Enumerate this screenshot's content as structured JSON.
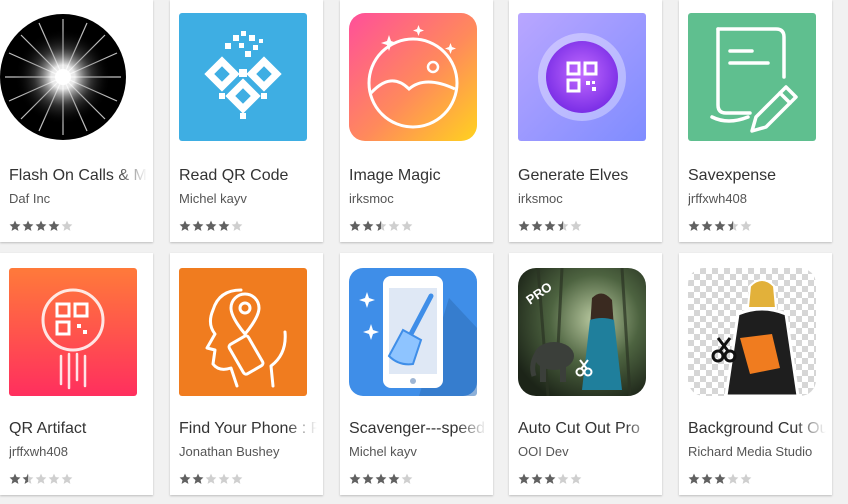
{
  "colors": {
    "star_on": "#616161",
    "star_off": "#cfcfcf"
  },
  "apps": [
    {
      "title": "Flash On Calls & Messages",
      "developer": "Daf Inc",
      "rating": 4,
      "icon": "flash-burst-icon"
    },
    {
      "title": "Read QR Code",
      "developer": "Michel kayv",
      "rating": 4,
      "icon": "qr-code-icon"
    },
    {
      "title": "Image Magic",
      "developer": "irksmoc",
      "rating": 2.5,
      "icon": "landscape-circle-icon"
    },
    {
      "title": "Generate Elves",
      "developer": "irksmoc",
      "rating": 3.5,
      "icon": "qr-orb-icon"
    },
    {
      "title": "Savexpense",
      "developer": "jrffxwh408",
      "rating": 3.5,
      "icon": "document-pen-icon"
    },
    {
      "title": "QR Artifact",
      "developer": "jrffxwh408",
      "rating": 1.5,
      "icon": "qr-circle-icon"
    },
    {
      "title": "Find Your Phone : Phone Finder",
      "developer": "Jonathan Bushey",
      "rating": 2,
      "icon": "location-head-icon"
    },
    {
      "title": "Scavenger---speed",
      "developer": "Michel kayv",
      "rating": 4,
      "icon": "phone-broom-icon"
    },
    {
      "title": "Auto Cut Out Pro",
      "developer": "OOI Dev",
      "rating": 3,
      "icon": "cutout-photo-icon"
    },
    {
      "title": "Background Cut Out",
      "developer": "Richard Media Studio",
      "rating": 3,
      "icon": "background-eraser-icon"
    }
  ]
}
